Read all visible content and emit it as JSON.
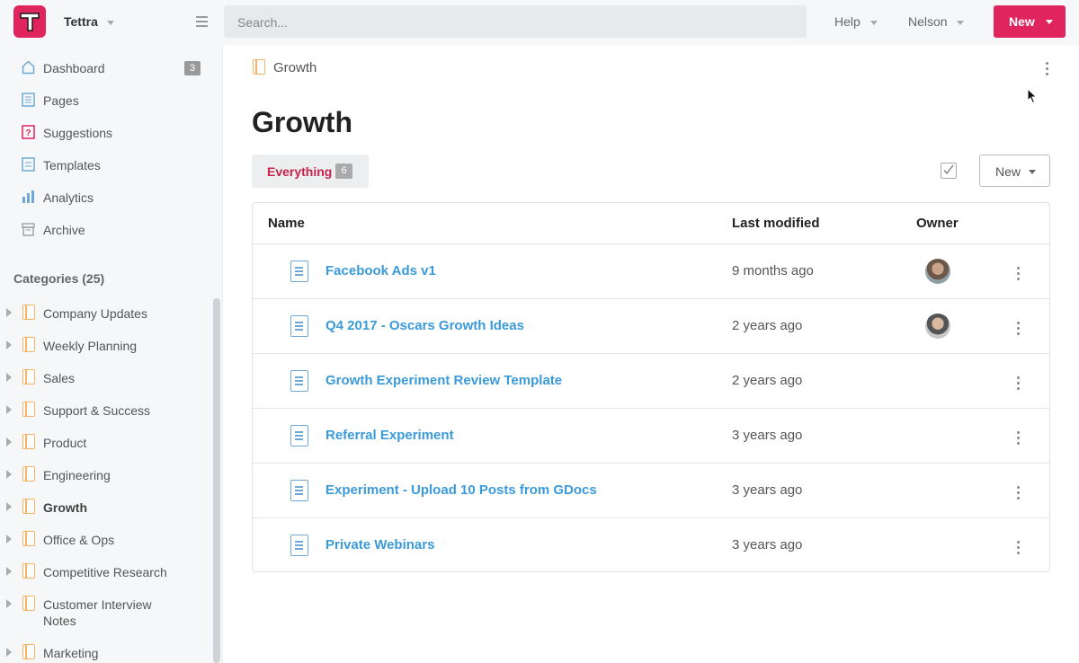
{
  "app": {
    "workspace": "Tettra",
    "search_placeholder": "Search...",
    "help": "Help",
    "user": "Nelson",
    "new_button": "New",
    "brand_color": "#e0245e"
  },
  "sidebar": {
    "nav": [
      {
        "label": "Dashboard",
        "icon": "home-icon",
        "badge": "3"
      },
      {
        "label": "Pages",
        "icon": "page-icon"
      },
      {
        "label": "Suggestions",
        "icon": "question-icon"
      },
      {
        "label": "Templates",
        "icon": "template-icon"
      },
      {
        "label": "Analytics",
        "icon": "chart-icon"
      },
      {
        "label": "Archive",
        "icon": "archive-icon"
      }
    ],
    "categories_heading": "Categories (25)",
    "categories": [
      {
        "label": "Company Updates"
      },
      {
        "label": "Weekly Planning"
      },
      {
        "label": "Sales"
      },
      {
        "label": "Support & Success"
      },
      {
        "label": "Product"
      },
      {
        "label": "Engineering"
      },
      {
        "label": "Growth",
        "active": true
      },
      {
        "label": "Office & Ops"
      },
      {
        "label": "Competitive Research"
      },
      {
        "label": "Customer Interview Notes"
      },
      {
        "label": "Marketing"
      }
    ]
  },
  "main": {
    "breadcrumb": "Growth",
    "title": "Growth",
    "tab": {
      "label": "Everything",
      "count": "6"
    },
    "new_button": "New",
    "table": {
      "headers": {
        "name": "Name",
        "modified": "Last modified",
        "owner": "Owner"
      },
      "rows": [
        {
          "title": "Facebook Ads v1",
          "modified": "9 months ago",
          "has_owner": true
        },
        {
          "title": "Q4 2017 - Oscars Growth Ideas",
          "modified": "2 years ago",
          "has_owner": true
        },
        {
          "title": "Growth Experiment Review Template",
          "modified": "2 years ago",
          "has_owner": false
        },
        {
          "title": "Referral Experiment",
          "modified": "3 years ago",
          "has_owner": false
        },
        {
          "title": "Experiment - Upload 10 Posts from GDocs",
          "modified": "3 years ago",
          "has_owner": false
        },
        {
          "title": "Private Webinars",
          "modified": "3 years ago",
          "has_owner": false
        }
      ]
    }
  }
}
